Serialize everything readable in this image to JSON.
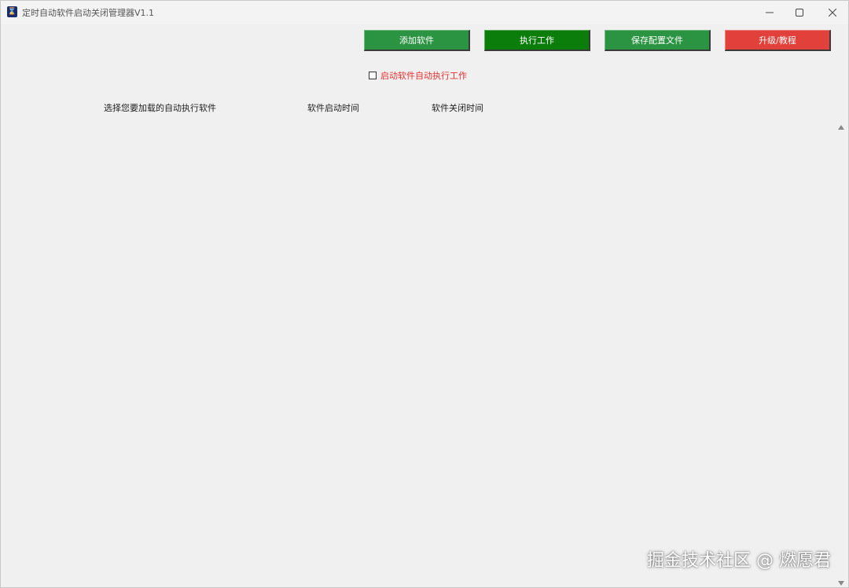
{
  "window": {
    "title": "定时自动软件启动关闭管理器V1.1",
    "icon": "hourglass-icon"
  },
  "toolbar": {
    "add_software": {
      "label": "添加软件",
      "color": "#2b9442"
    },
    "execute_work": {
      "label": "执行工作",
      "color": "#0b7d0b"
    },
    "save_config": {
      "label": "保存配置文件",
      "color": "#2b9442"
    },
    "upgrade_tutorial": {
      "label": "升级/教程",
      "color": "#e2403a"
    }
  },
  "options": {
    "autostart_label": "启动软件自动执行工作",
    "autostart_checked": false,
    "label_color": "#e83030"
  },
  "table": {
    "columns": [
      {
        "label": "选择您要加载的自动执行软件"
      },
      {
        "label": "软件启动时间"
      },
      {
        "label": "软件关闭时间"
      }
    ],
    "rows": []
  },
  "watermark": "掘金技术社区 @ 燃愿君"
}
